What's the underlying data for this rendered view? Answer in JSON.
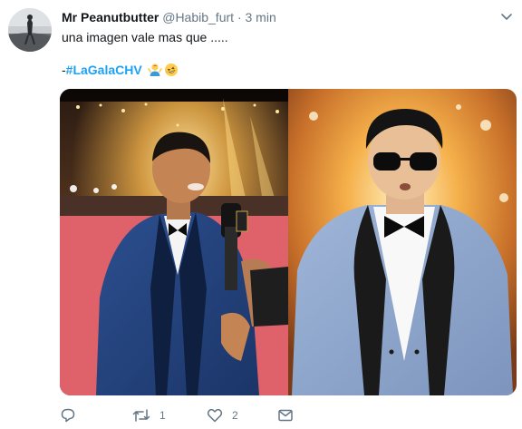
{
  "tweet": {
    "display_name": "Mr Peanutbutter",
    "handle": "@Habib_furt",
    "separator": "·",
    "time": "3 min",
    "text_line1": "una imagen vale mas que .....",
    "text_prefix": "-",
    "hashtag": "#LaGalaCHV",
    "emojis": [
      "man-shrugging-emoji",
      "rofl-emoji"
    ]
  },
  "actions": {
    "reply_count": "",
    "retweet_count": "1",
    "like_count": "2"
  },
  "icons": {
    "caret": "chevron-down-icon",
    "reply": "reply-icon",
    "retweet": "retweet-icon",
    "like": "heart-icon",
    "dm": "envelope-icon"
  },
  "colors": {
    "hashtag": "#1da1f2",
    "secondary_text": "#657786",
    "primary_text": "#14171a"
  }
}
